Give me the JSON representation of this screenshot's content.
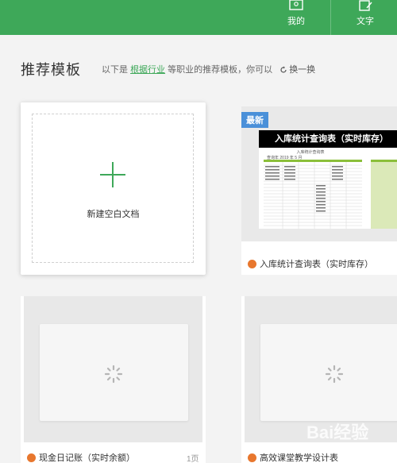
{
  "topbar": {
    "tabs": [
      {
        "label": "我的",
        "icon": "user-icon"
      },
      {
        "label": "文字",
        "icon": "document-edit-icon"
      }
    ]
  },
  "section": {
    "title": "推荐模板",
    "subline_prefix": "以下是",
    "subline_link": "根据行业",
    "subline_suffix": "等职业的推荐模板，你可以",
    "refresh_label": "换一换"
  },
  "new_blank": {
    "label": "新建空白文档"
  },
  "templates": [
    {
      "badge": "最新",
      "banner": "入库统计查询表（实时库存）",
      "mini_header": "入库统计查询表",
      "query_row": "查询年  2019  年   5   月",
      "title": "入库统计查询表（实时库存）",
      "pages": ""
    },
    {
      "title": "现金日记账（实时余额）",
      "pages": "1页"
    },
    {
      "title": "高效课堂教学设计表",
      "pages": ""
    }
  ],
  "watermark": "Bai经验",
  "colors": {
    "brand_green": "#3ea859",
    "badge_blue": "#4a90d9",
    "file_icon_orange": "#e8772e"
  }
}
